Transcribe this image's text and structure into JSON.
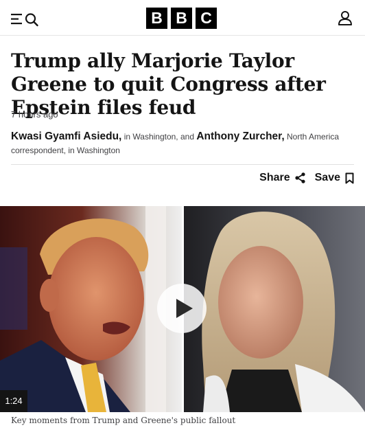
{
  "header": {
    "brand_letters": [
      "B",
      "B",
      "C"
    ],
    "menu_icon": "menu-icon",
    "search_icon": "search-icon",
    "account_icon": "account-icon"
  },
  "article": {
    "headline": "Trump ally Marjorie Taylor Greene to quit Congress after Epstein files feud",
    "timestamp": "7 hours ago",
    "authors": [
      {
        "name": "Kwasi Gyamfi Asiedu,",
        "detail": " in Washington, and "
      },
      {
        "name": "Anthony Zurcher,",
        "detail": " North America correspondent, in Washington"
      }
    ],
    "share_label": "Share",
    "save_label": "Save"
  },
  "video": {
    "duration": "1:24",
    "caption": "Key moments from Trump and Greene's public fallout",
    "play_icon": "play-icon"
  }
}
